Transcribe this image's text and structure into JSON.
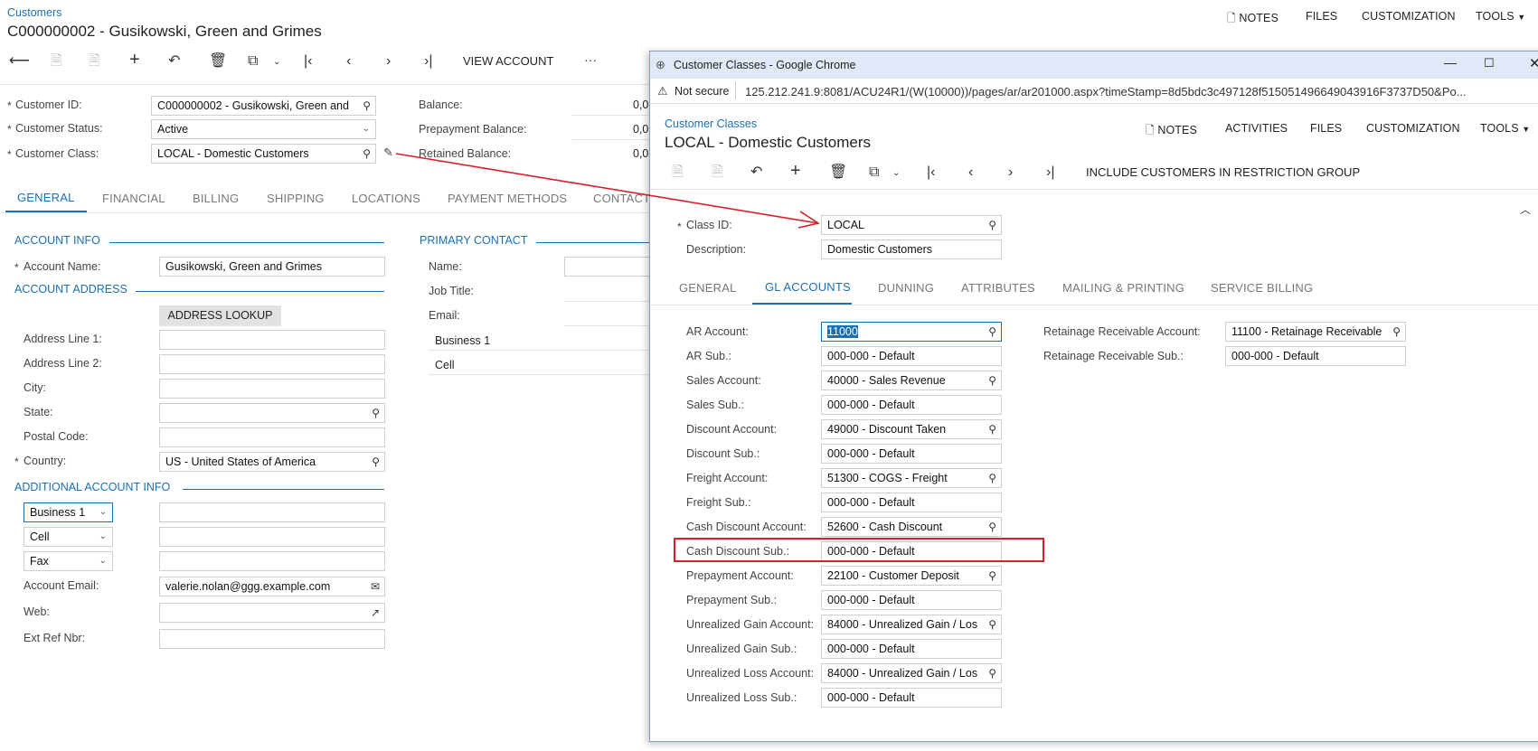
{
  "main": {
    "breadcrumb": "Customers",
    "title": "C000000002 - Gusikowski, Green and Grimes",
    "topnav": {
      "notes": "NOTES",
      "files": "FILES",
      "customization": "CUSTOMIZATION",
      "tools": "TOOLS"
    },
    "toolbar": {
      "view_account": "VIEW ACCOUNT",
      "more": "···"
    },
    "header_fields": {
      "customer_id_label": "Customer ID:",
      "customer_id": "C000000002 - Gusikowski, Green and",
      "customer_status_label": "Customer Status:",
      "customer_status": "Active",
      "customer_class_label": "Customer Class:",
      "customer_class": "LOCAL - Domestic Customers",
      "balance_label": "Balance:",
      "balance": "0,0",
      "prepayment_label": "Prepayment Balance:",
      "prepayment": "0,0",
      "retained_label": "Retained Balance:",
      "retained": "0,0"
    },
    "tabs": [
      "GENERAL",
      "FINANCIAL",
      "BILLING",
      "SHIPPING",
      "LOCATIONS",
      "PAYMENT METHODS",
      "CONTACT"
    ],
    "account_info": {
      "header": "ACCOUNT INFO",
      "account_name_label": "Account Name:",
      "account_name": "Gusikowski, Green and Grimes"
    },
    "account_address": {
      "header": "ACCOUNT ADDRESS",
      "lookup": "ADDRESS LOOKUP",
      "line1": "Address Line 1:",
      "line2": "Address Line 2:",
      "city": "City:",
      "state": "State:",
      "postal": "Postal Code:",
      "country_label": "Country:",
      "country": "US - United States of America"
    },
    "additional": {
      "header": "ADDITIONAL ACCOUNT INFO",
      "phone1": "Business 1",
      "phone2": "Cell",
      "phone3": "Fax",
      "email_label": "Account Email:",
      "email": "valerie.nolan@ggg.example.com",
      "web_label": "Web:",
      "ext_label": "Ext Ref Nbr:"
    },
    "primary_contact": {
      "header": "PRIMARY CONTACT",
      "name": "Name:",
      "job": "Job Title:",
      "email": "Email:",
      "business": "Business 1",
      "cell": "Cell"
    }
  },
  "popup": {
    "window_title": "Customer Classes - Google Chrome",
    "not_secure": "Not secure",
    "url": "125.212.241.9:8081/ACU24R1/(W(10000))/pages/ar/ar201000.aspx?timeStamp=8d5bdc3c497128f515051496649043916F3737D50&Po...",
    "breadcrumb": "Customer Classes",
    "title": "LOCAL - Domestic Customers",
    "topnav": {
      "notes": "NOTES",
      "activities": "ACTIVITIES",
      "files": "FILES",
      "customization": "CUSTOMIZATION",
      "tools": "TOOLS"
    },
    "toolbar_action": "INCLUDE CUSTOMERS IN RESTRICTION GROUP",
    "class_id_label": "Class ID:",
    "class_id": "LOCAL",
    "description_label": "Description:",
    "description": "Domestic Customers",
    "tabs": [
      "GENERAL",
      "GL ACCOUNTS",
      "DUNNING",
      "ATTRIBUTES",
      "MAILING & PRINTING",
      "SERVICE BILLING"
    ],
    "gl_fields": [
      {
        "label": "AR Account:",
        "value": "11000"
      },
      {
        "label": "AR Sub.:",
        "value": "000-000 - Default"
      },
      {
        "label": "Sales Account:",
        "value": "40000 - Sales Revenue"
      },
      {
        "label": "Sales Sub.:",
        "value": "000-000 - Default"
      },
      {
        "label": "Discount Account:",
        "value": "49000 - Discount Taken"
      },
      {
        "label": "Discount Sub.:",
        "value": "000-000 - Default"
      },
      {
        "label": "Freight Account:",
        "value": "51300 - COGS - Freight"
      },
      {
        "label": "Freight Sub.:",
        "value": "000-000 - Default"
      },
      {
        "label": "Cash Discount Account:",
        "value": "52600 - Cash Discount"
      },
      {
        "label": "Cash Discount Sub.:",
        "value": "000-000 - Default"
      },
      {
        "label": "Prepayment Account:",
        "value": "22100 - Customer Deposit"
      },
      {
        "label": "Prepayment Sub.:",
        "value": "000-000 - Default"
      },
      {
        "label": "Unrealized Gain Account:",
        "value": "84000 - Unrealized Gain / Los"
      },
      {
        "label": "Unrealized Gain Sub.:",
        "value": "000-000 - Default"
      },
      {
        "label": "Unrealized Loss Account:",
        "value": "84000 - Unrealized Gain / Los"
      },
      {
        "label": "Unrealized Loss Sub.:",
        "value": "000-000 - Default"
      }
    ],
    "retainage_account_label": "Retainage Receivable Account:",
    "retainage_account": "11100 - Retainage Receivable",
    "retainage_sub_label": "Retainage Receivable Sub.:",
    "retainage_sub": "000-000 - Default"
  },
  "colors": {
    "accent": "#1a6fb5",
    "annotation": "#d8202a"
  }
}
